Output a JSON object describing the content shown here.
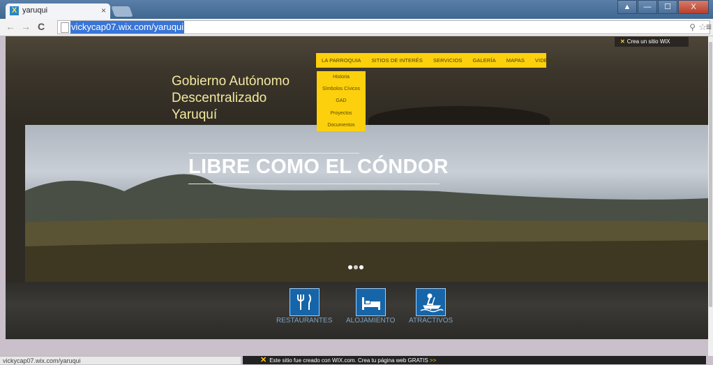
{
  "browser": {
    "tab_title": "yaruqui",
    "tab_close": "×",
    "url": "vickycap07.wix.com/yaruqui",
    "back": "←",
    "forward": "→",
    "reload": "C",
    "zoom_icon": "⚲",
    "star_icon": "☆",
    "menu_icon": "≡",
    "window_buttons": [
      "▲",
      "—",
      "☐",
      "X"
    ],
    "status_url": "vickycap07.wix.com/yaruqui"
  },
  "wix": {
    "badge": "Crea un sitio WiX",
    "banner_text": "Este sitio fue creado con WIX.com. Crea tu página web GRATIS",
    "banner_arrow": ">>"
  },
  "site": {
    "title_lines": [
      "Gobierno Autónomo",
      "Descentralizado",
      "Yaruquí"
    ],
    "nav": [
      "LA PARROQUIA",
      "SITIOS DE INTERÉS",
      "SERVICIOS",
      "GALERÍA",
      "MAPAS",
      "VIDEOS"
    ],
    "dropdown": [
      "Historia",
      "Símbolos Cívicos",
      "GAD",
      "Proyectos",
      "Documentos"
    ],
    "hero_title": "LIBRE COMO EL CÓNDOR",
    "slides_total": 3,
    "slide_active": 1,
    "features": [
      "RESTAURANTES",
      "ALOJAMIENTO",
      "ATRACTIVOS"
    ]
  },
  "colors": {
    "nav_bg": "#fcd00c",
    "feature_icon_bg": "#1565a8",
    "title_color": "#f3e9a0"
  }
}
